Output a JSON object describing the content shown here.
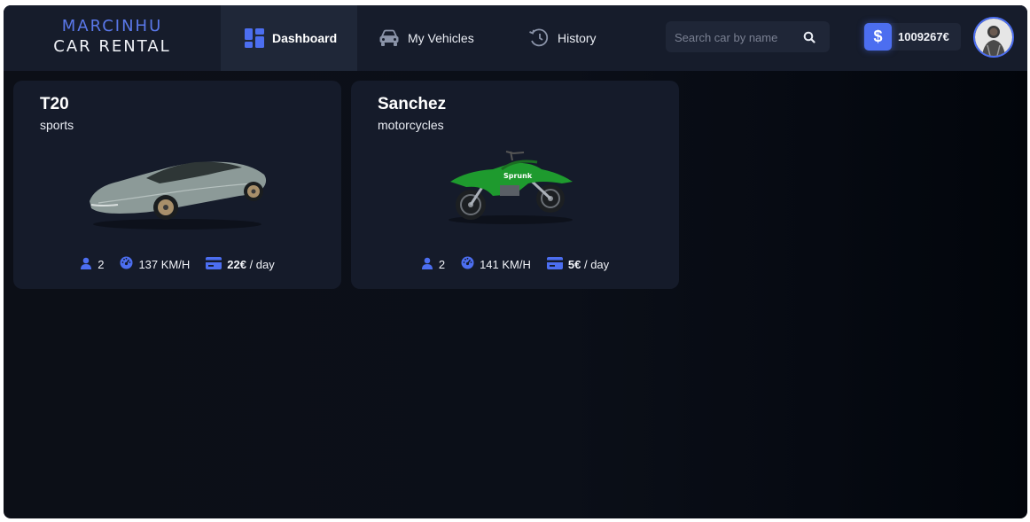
{
  "brand": {
    "line1": "MARCINHU",
    "line2": "CAR RENTAL"
  },
  "nav": {
    "dashboard": {
      "label": "Dashboard",
      "icon": "dashboard-icon"
    },
    "vehicles": {
      "label": "My Vehicles",
      "icon": "car-icon"
    },
    "history": {
      "label": "History",
      "icon": "history-icon"
    }
  },
  "search": {
    "placeholder": "Search car by name",
    "value": ""
  },
  "balance": {
    "currency_symbol": "$",
    "amount": "1009267€"
  },
  "colors": {
    "accent": "#4c6ef0",
    "brand_blue": "#5a78ea",
    "card_bg": "#151b2a",
    "topbar_bg": "#161c2b"
  },
  "vehicles": [
    {
      "name": "T20",
      "category": "sports",
      "seats": "2",
      "speed": "137 KM/H",
      "price": "22€",
      "price_unit": " / day"
    },
    {
      "name": "Sanchez",
      "category": "motorcycles",
      "seats": "2",
      "speed": "141 KM/H",
      "price": "5€",
      "price_unit": " / day"
    }
  ]
}
